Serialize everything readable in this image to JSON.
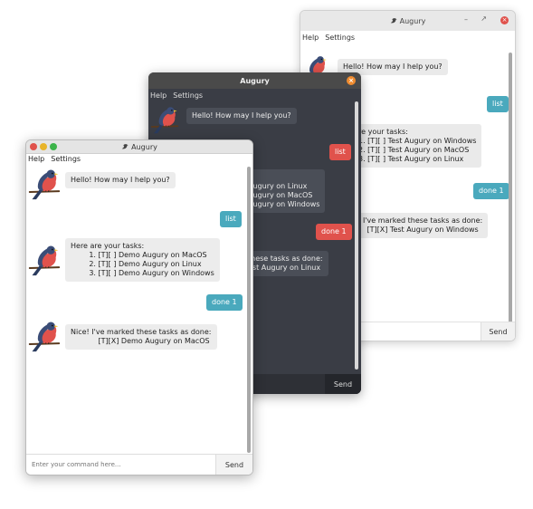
{
  "colors": {
    "bot_bubble_light": "#ececec",
    "user_bubble_teal": "#4aa9bd",
    "user_bubble_red": "#e0524c",
    "dark_bg": "#3a3d45",
    "close_red": "#e0524c",
    "close_orange": "#f08c30"
  },
  "window_a": {
    "title": "Augury",
    "menu": [
      "Help",
      "Settings"
    ],
    "messages": [
      "Hello! How may I help you?",
      "list",
      "re your tasks:\n1. [T][ ] Test Augury on Windows\n2. [T][ ] Test Augury on MacOS\n3. [T][ ] Test Augury on Linux",
      "done 1",
      "I've marked these tasks as done:\n[T][X] Test Augury on Windows"
    ],
    "input_placeholder": "Enter your command here...",
    "input_visible": "here...",
    "send_label": "Send"
  },
  "window_b": {
    "title": "Augury",
    "menu": [
      "Help",
      "Settings"
    ],
    "messages": [
      "Hello! How may I help you?",
      "list",
      "s:\nAugury on Linux\nAugury on MacOS\nAugury on Windows",
      "done 1",
      "these tasks as done:\nest Augury on Linux"
    ],
    "input_placeholder": "",
    "send_label": "Send"
  },
  "window_c": {
    "title": "Augury",
    "menu": [
      "Help",
      "Settings"
    ],
    "messages": [
      "Hello! How may I help you?",
      "list",
      "Here are your tasks:\n        1. [T][ ] Demo Augury on MacOS\n        2. [T][ ] Demo Augury on Linux\n        3. [T][ ] Demo Augury on Windows",
      "done 1",
      "Nice! I've marked these tasks as done:\n            [T][X] Demo Augury on MacOS"
    ],
    "input_placeholder": "Enter your command here...",
    "send_label": "Send"
  }
}
